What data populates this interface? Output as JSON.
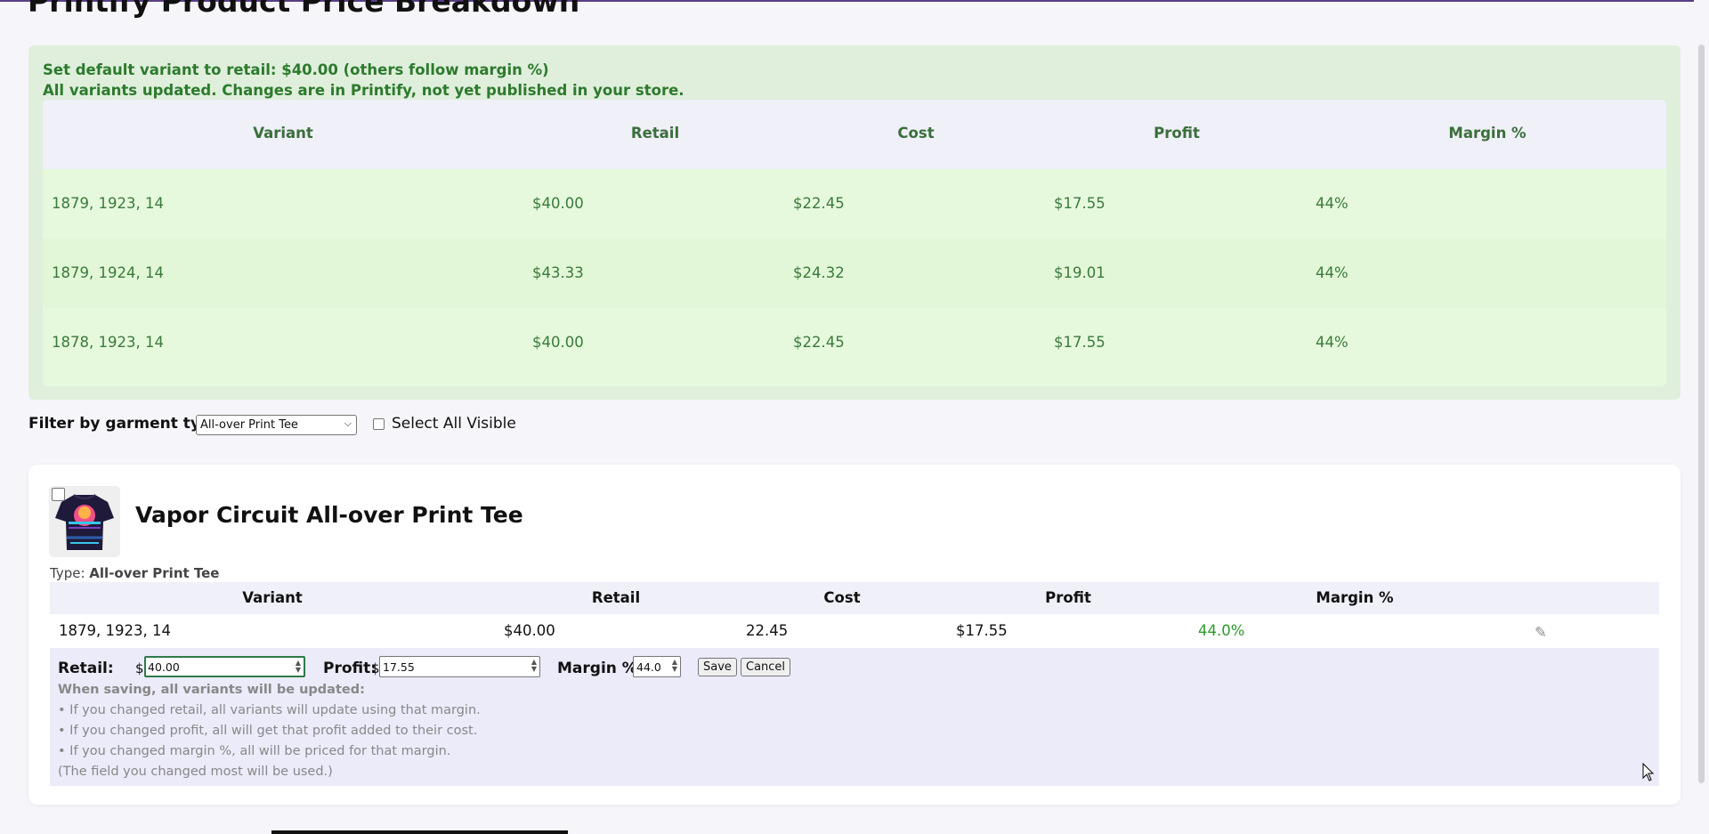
{
  "page": {
    "title": "Printify Product Price Breakdown"
  },
  "success": {
    "line1": "Set default variant to retail: $40.00 (others follow margin %)",
    "line2": "All variants updated. Changes are in Printify, not yet published in your store.",
    "color": "#2d7a2d",
    "columns": [
      "Variant",
      "Retail",
      "Cost",
      "Profit",
      "Margin %"
    ],
    "rows": [
      [
        "1879, 1923, 14",
        "$40.00",
        "$22.45",
        "$17.55",
        "44%"
      ],
      [
        "1879, 1924, 14",
        "$43.33",
        "$24.32",
        "$19.01",
        "44%"
      ],
      [
        "1878, 1923, 14",
        "$40.00",
        "$22.45",
        "$17.55",
        "44%"
      ]
    ]
  },
  "filter": {
    "label": "Filter by garment type:",
    "selected": "All-over Print Tee",
    "select_all_label": "Select All Visible"
  },
  "product": {
    "title": "Vapor Circuit All-over Print Tee",
    "type_label": "Type:",
    "type_value": "All-over Print Tee",
    "columns": [
      "Variant",
      "Retail",
      "Cost",
      "Profit",
      "Margin %"
    ],
    "row": {
      "variant": "1879, 1923, 14",
      "retail": "$40.00",
      "cost": "22.45",
      "profit": "$17.55",
      "margin": "44.0%",
      "edit_icon": "pencil-icon"
    },
    "edit": {
      "retail_label": "Retail:",
      "retail_value": "40.00",
      "profit_label": "Profit:",
      "profit_value": "17.55",
      "margin_label": "Margin %:",
      "margin_value": "44.0",
      "currency": "$",
      "save_label": "Save",
      "cancel_label": "Cancel",
      "notes": [
        "When saving, all variants will be updated:",
        "• If you changed retail, all variants will update using that margin.",
        "• If you changed profit, all will get that profit added to their cost.",
        "• If you changed margin %, all will be priced for that margin.",
        "(The field you changed most will be used.)"
      ]
    }
  }
}
